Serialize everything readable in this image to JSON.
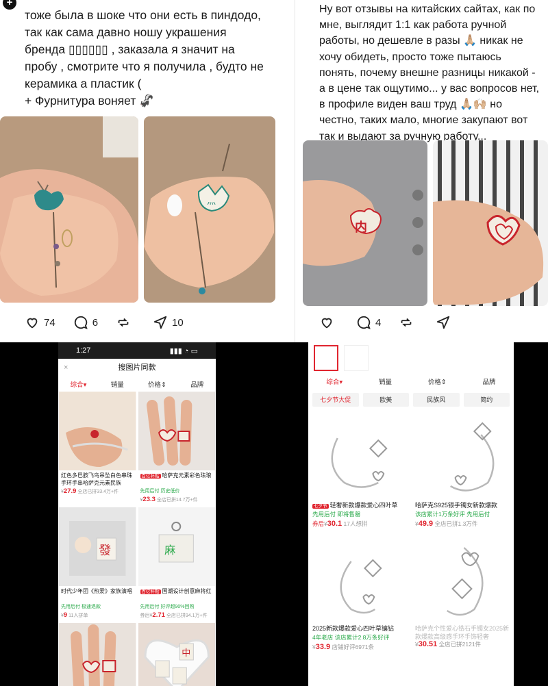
{
  "left_post": {
    "lines": [
      "тоже была в шоке что они есть в пиндодо,",
      "так как сама давно ношу украшения",
      "бренда ▯▯▯▯▯▯ , заказала я значит на",
      "пробу , смотрите что я получила , будто не",
      "керамика а пластик (",
      "+ Фурнитура воняет 🦨"
    ],
    "likes": "74",
    "comments": "6",
    "shares": "10"
  },
  "right_post": {
    "lines": [
      "Ну вот отзывы на китайских сайтах, как по",
      "мне, выглядит 1:1 как работа ручной",
      "работы, но дешевле в разы 🙏🏼 никак не",
      "хочу обидеть, просто тоже пытаюсь",
      "понять, почему внешне разницы никакой -",
      "а в цене так ощутимо... у вас вопросов нет,",
      "в профиле виден ваш труд 🙏🏼🙌🏼 но",
      "честно, таких мало, многие закупают вот",
      "так и выдают за ручную работу..."
    ],
    "comments": "4"
  },
  "left_app": {
    "time": "1:27",
    "sheet_title": "搜图片同款",
    "close": "×",
    "tabs": [
      "综合▾",
      "销量",
      "价格⇕",
      "品牌"
    ],
    "cards": [
      {
        "title": "红色多巴胺飞鸟吊坠白色串珠手环手串哈萨克元素民族",
        "hot": "",
        "tags": "",
        "price": "27.9",
        "sold": "全店已拼33.4万+件"
      },
      {
        "title": "哈萨克元素彩色珐琅",
        "hot": "百亿补贴",
        "tags": "先用后付  历史低价",
        "price": "23.3",
        "sold": "全店已拼14.7万+件"
      },
      {
        "title": "时代少年团《热爱》家族演唱",
        "hot": "",
        "tags": "先用后付  极速退款",
        "price": "9",
        "sold": "11人拼单"
      },
      {
        "title": "国潮设计创意麻将红",
        "hot": "百亿补贴",
        "tags": "先用后付  好评超90%回购",
        "price": "2.71",
        "sold": "全店已拼94.1万+件"
      },
      {
        "title": "",
        "hot": "",
        "tags": "",
        "price": "",
        "sold": ""
      },
      {
        "title": "",
        "hot": "",
        "tags": "",
        "price": "",
        "sold": ""
      }
    ]
  },
  "right_app": {
    "tabs": [
      "综合▾",
      "销量",
      "价格⇕",
      "品牌"
    ],
    "chips": [
      "七夕节大促",
      "欧美",
      "民族风",
      "简约"
    ],
    "cards": [
      {
        "title": "轻奢新款爆款爱心四叶草",
        "hot": "七夕节",
        "tags": "先用后付  即将售罄",
        "prefix": "券后",
        "price": "30.1",
        "sold": "17人想拼"
      },
      {
        "title": "哈萨克S925银手镯女新款爆款",
        "hot": "",
        "tags": "该店累计1万条好评  先用后付",
        "prefix": "",
        "price": "49.9",
        "sold": "全店已拼1.3万件"
      },
      {
        "title": "2025新款爆款爱心四叶草镶钻",
        "hot": "",
        "tags": "4年老店  该店累计2.8万条好评",
        "prefix": "",
        "price": "33.9",
        "sold": "店铺好评6971条"
      },
      {
        "title": "哈萨克个性爱心锆石手镯女2025新款爆款高级感手环手饰轻奢",
        "hot": "",
        "tags": "",
        "prefix": "",
        "price": "30.51",
        "sold": "全店已拼2121件"
      }
    ]
  },
  "colors": {
    "accent": "#e0252f",
    "green": "#2aa94a"
  }
}
